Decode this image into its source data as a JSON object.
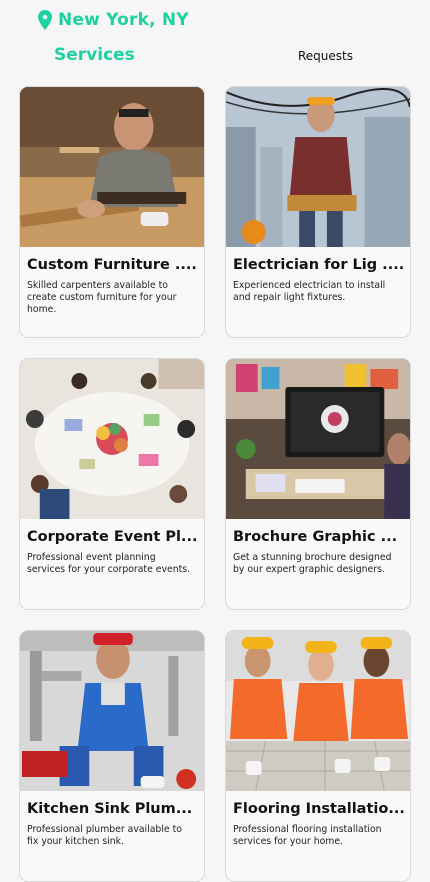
{
  "header": {
    "location": "New York,  NY",
    "icon": "location-pin-icon",
    "accent_color": "#1ed1a1"
  },
  "tabs": {
    "services": "Services",
    "requests": "Requests"
  },
  "services": [
    {
      "title": "Custom Furniture ....",
      "description": "Skilled carpenters available to create custom furniture for your home."
    },
    {
      "title": "Electrician for Lig ....",
      "description": "Experienced electrician to install and repair light fixtures."
    },
    {
      "title": "Corporate Event Pl...",
      "description": "Professional event planning services for your corporate events."
    },
    {
      "title": "Brochure Graphic ...",
      "description": "Get a stunning brochure designed by our expert graphic designers."
    },
    {
      "title": "Kitchen Sink Plum...",
      "description": "Professional plumber available to fix your kitchen sink."
    },
    {
      "title": "Flooring Installatio...",
      "description": "Professional flooring installation services for your home."
    }
  ]
}
